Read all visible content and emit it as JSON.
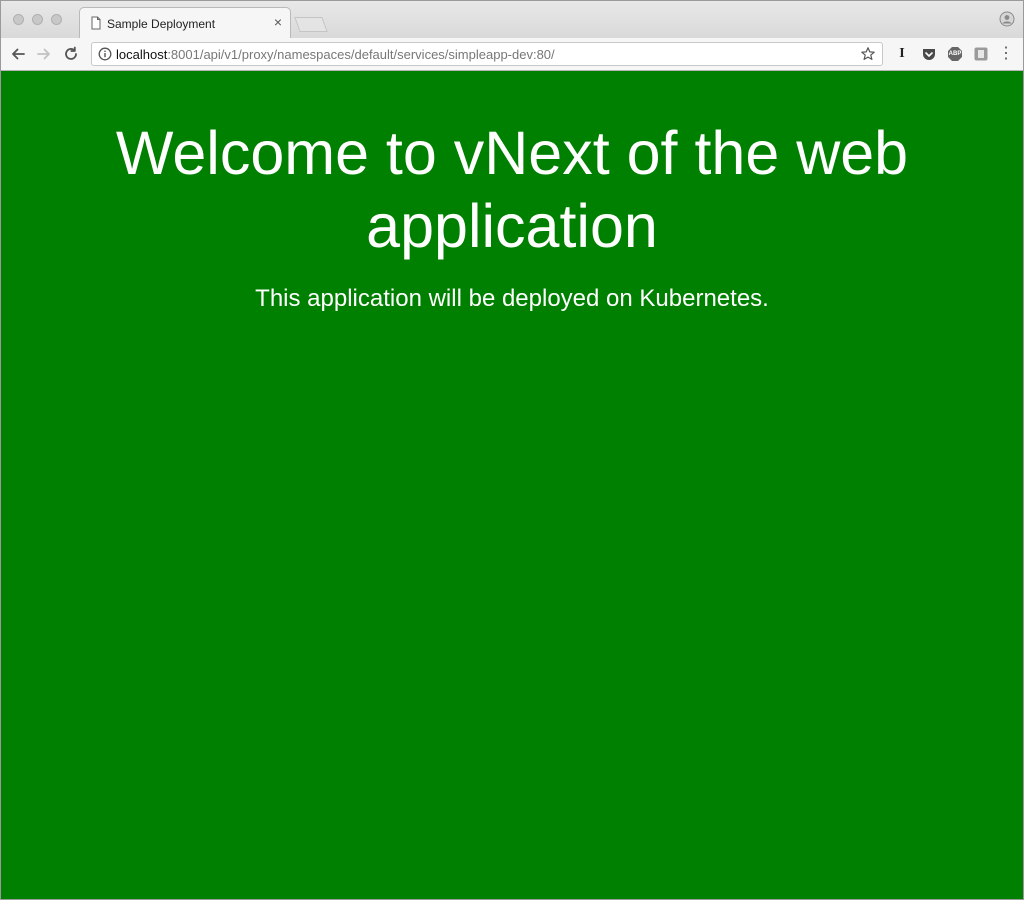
{
  "browser": {
    "tab": {
      "title": "Sample Deployment",
      "close_glyph": "×",
      "icon": "page-icon"
    },
    "address_bar": {
      "host": "localhost",
      "path": ":8001/api/v1/proxy/namespaces/default/services/simpleapp-dev:80/"
    },
    "toolbar_icons": [
      "back-icon",
      "forward-icon",
      "reload-icon",
      "info-icon",
      "bookmark-star-icon"
    ],
    "extensions": [
      {
        "name": "instapaper-extension-icon",
        "label": "I"
      },
      {
        "name": "pocket-extension-icon",
        "label": ""
      },
      {
        "name": "adblock-plus-extension-icon",
        "label": "ABP"
      },
      {
        "name": "extension-icon",
        "label": ""
      }
    ],
    "menu_glyph": "⋮"
  },
  "page": {
    "heading": "Welcome to vNext of the web application",
    "subheading": "This application will be deployed on Kubernetes.",
    "background_color": "#008000",
    "text_color": "#ffffff"
  }
}
